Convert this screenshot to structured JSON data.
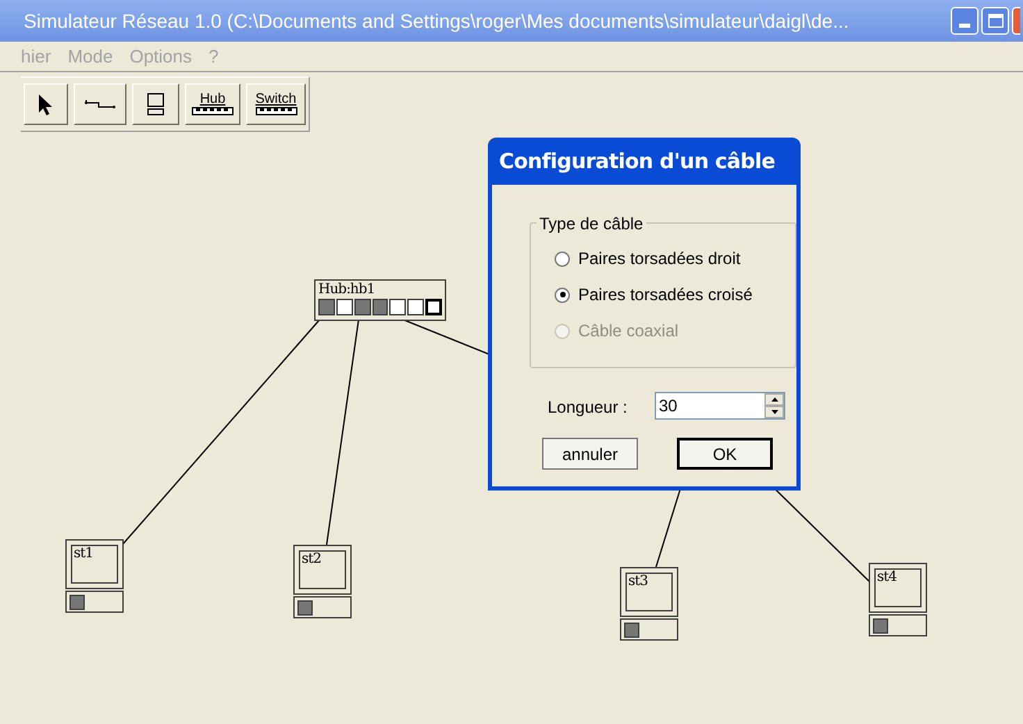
{
  "window": {
    "title": "Simulateur Réseau 1.0 (C:\\Documents and Settings\\roger\\Mes documents\\simulateur\\daigl\\de..."
  },
  "menu": [
    "hier",
    "Mode",
    "Options",
    "?"
  ],
  "toolbar": [
    {
      "kind": "pointer"
    },
    {
      "kind": "cable"
    },
    {
      "kind": "station"
    },
    {
      "kind": "hub",
      "label": "Hub"
    },
    {
      "kind": "switch",
      "label": "Switch"
    }
  ],
  "hub": {
    "label": "Hub:hb1",
    "ports": [
      {
        "used": true,
        "selected": false
      },
      {
        "used": false,
        "selected": false
      },
      {
        "used": true,
        "selected": false
      },
      {
        "used": true,
        "selected": false
      },
      {
        "used": false,
        "selected": false
      },
      {
        "used": false,
        "selected": false
      },
      {
        "used": false,
        "selected": true
      }
    ]
  },
  "stations": [
    {
      "label": "st1"
    },
    {
      "label": "st2"
    },
    {
      "label": "st3"
    },
    {
      "label": "st4"
    }
  ],
  "dialog": {
    "title": "Configuration d'un câble",
    "group": "Type de câble",
    "options": [
      {
        "label": "Paires torsadées droit",
        "selected": false,
        "disabled": false
      },
      {
        "label": "Paires torsadées croisé",
        "selected": true,
        "disabled": false
      },
      {
        "label": "Câble coaxial",
        "selected": false,
        "disabled": true
      }
    ],
    "length_label": "Longueur :",
    "length_value": "30",
    "buttons": [
      "annuler",
      "OK"
    ]
  }
}
